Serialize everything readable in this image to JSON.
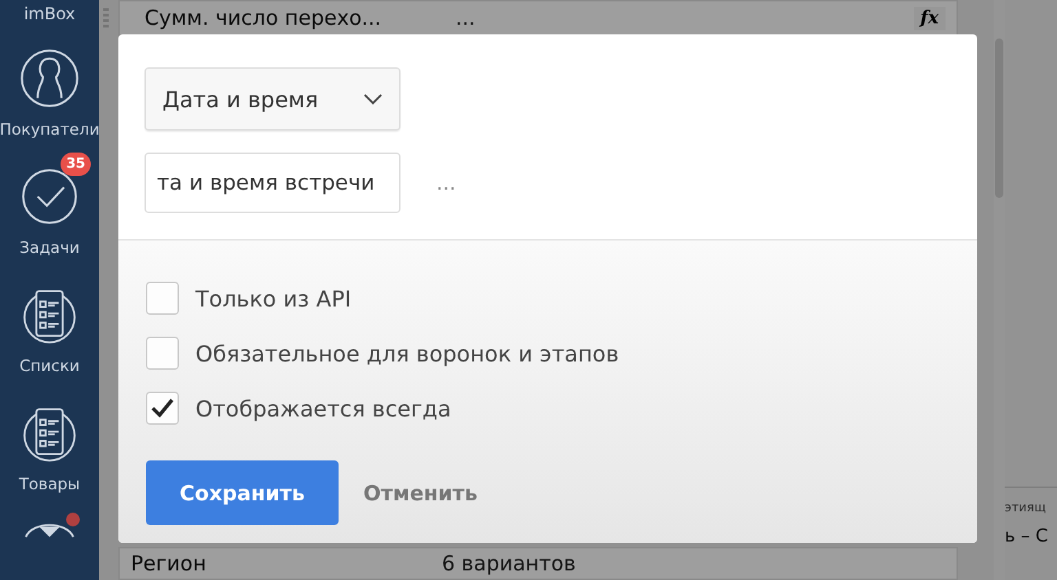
{
  "sidebar": {
    "items": [
      {
        "kind": "text",
        "label": "imBox"
      },
      {
        "kind": "people",
        "label": "Покупатели"
      },
      {
        "kind": "check",
        "label": "Задачи",
        "badge": "35"
      },
      {
        "kind": "list",
        "label": "Списки"
      },
      {
        "kind": "list",
        "label": "Товары"
      },
      {
        "kind": "more"
      }
    ]
  },
  "background": {
    "top_row": {
      "name": "Сумм. число перехо...",
      "value": "...",
      "button": "fx"
    },
    "bottom_row": {
      "name": "Регион",
      "value": "6 вариантов"
    },
    "side_texts": [
      "этиящ",
      "ь – С"
    ]
  },
  "modal": {
    "type_select": {
      "value": "Дата и время"
    },
    "name_field": {
      "value": "та и время встречи"
    },
    "more": "...",
    "options": [
      {
        "label": "Только из API",
        "checked": false
      },
      {
        "label": "Обязательное для воронок и этапов",
        "checked": false
      },
      {
        "label": "Отображается всегда",
        "checked": true
      }
    ],
    "buttons": [
      {
        "kind": "primary",
        "label": "Сохранить"
      },
      {
        "kind": "link",
        "label": "Отменить"
      }
    ]
  }
}
